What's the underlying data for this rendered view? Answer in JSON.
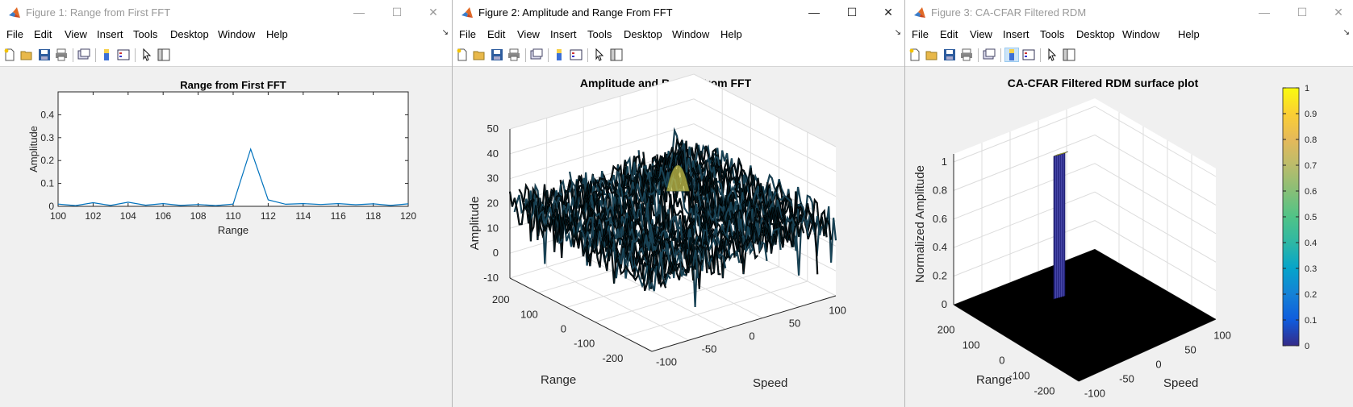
{
  "windows": [
    {
      "title": "Figure 1: Range from First FFT",
      "active": false,
      "menu": [
        "File",
        "Edit",
        "View",
        "Insert",
        "Tools",
        "Desktop",
        "Window",
        "Help"
      ],
      "chart_data": {
        "type": "line",
        "title": "Range from First FFT",
        "xlabel": "Range",
        "ylabel": "Amplitude",
        "xlim": [
          100,
          120
        ],
        "ylim": [
          0,
          0.5
        ],
        "x_ticks": [
          "100",
          "102",
          "104",
          "106",
          "108",
          "110",
          "112",
          "114",
          "116",
          "118",
          "120"
        ],
        "y_ticks": [
          "0",
          "0.1",
          "0.2",
          "0.3",
          "0.4"
        ],
        "grid": false,
        "series": [
          {
            "color": "#0072bd",
            "x": [
              100,
              101,
              102,
              103,
              104,
              105,
              106,
              107,
              108,
              109,
              110,
              111,
              112,
              113,
              114,
              115,
              116,
              117,
              118,
              119,
              120
            ],
            "y": [
              0.01,
              0.003,
              0.016,
              0.004,
              0.018,
              0.005,
              0.012,
              0.004,
              0.008,
              0.003,
              0.01,
              0.25,
              0.028,
              0.009,
              0.012,
              0.008,
              0.012,
              0.007,
              0.011,
              0.004,
              0.011
            ]
          }
        ]
      }
    },
    {
      "title": "Figure 2: Amplitude and Range From FFT",
      "active": true,
      "menu": [
        "File",
        "Edit",
        "View",
        "Insert",
        "Tools",
        "Desktop",
        "Window",
        "Help"
      ],
      "chart_data": {
        "type": "surface",
        "title": "Amplitude and Range From FFT",
        "xlabel": "Speed",
        "ylabel": "Range",
        "zlabel": "Amplitude",
        "x_ticks": [
          "-100",
          "-50",
          "0",
          "50",
          "100"
        ],
        "y_ticks": [
          "200",
          "100",
          "0",
          "-100",
          "-200"
        ],
        "z_ticks": [
          "50",
          "40",
          "30",
          "20",
          "10",
          "0",
          "-10"
        ],
        "zlim": [
          -10,
          50
        ],
        "colormap": "parula",
        "peak": {
          "speed": -20,
          "range": 110,
          "amplitude": 42
        },
        "noise_floor": 20
      }
    },
    {
      "title": "Figure 3: CA-CFAR Filtered RDM",
      "active": false,
      "menu": [
        "File",
        "Edit",
        "View",
        "Insert",
        "Tools",
        "Desktop",
        "Window",
        "Help"
      ],
      "chart_data": {
        "type": "surface",
        "title": "CA-CFAR Filtered RDM surface plot",
        "xlabel": "Speed",
        "ylabel": "Range",
        "zlabel": "Normalized Amplitude",
        "x_ticks": [
          "-100",
          "-50",
          "0",
          "50",
          "100"
        ],
        "y_ticks": [
          "200",
          "100",
          "0",
          "-100",
          "-200"
        ],
        "z_ticks": [
          "1",
          "0.8",
          "0.6",
          "0.4",
          "0.2",
          "0"
        ],
        "zlim": [
          0,
          1
        ],
        "colorbar_ticks": [
          "1",
          "0.9",
          "0.8",
          "0.7",
          "0.6",
          "0.5",
          "0.4",
          "0.3",
          "0.2",
          "0.1",
          "0"
        ],
        "colormap": "parula",
        "peak": {
          "speed": -20,
          "range": 110,
          "amplitude": 1
        }
      }
    }
  ]
}
